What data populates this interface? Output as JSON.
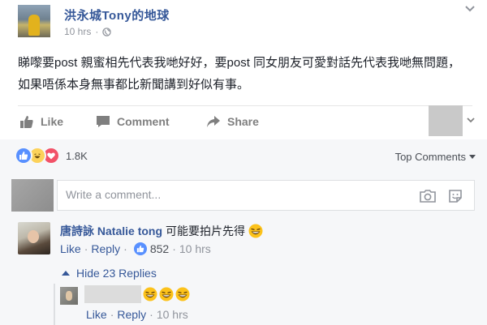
{
  "post": {
    "poster_name": "洪永城Tony的地球",
    "time": "10 hrs",
    "separator": "·",
    "text": "睇嚟要post 親蜜相先代表我哋好好，要post 同女朋友可愛對話先代表我哋無問題，如果唔係本身無事都比新聞講到好似有事。"
  },
  "actions": {
    "like": "Like",
    "comment": "Comment",
    "share": "Share"
  },
  "reactions": {
    "count": "1.8K",
    "types": [
      "like-icon",
      "haha-icon",
      "love-icon"
    ]
  },
  "sort": {
    "label": "Top Comments"
  },
  "composer": {
    "placeholder": "Write a comment..."
  },
  "comments": [
    {
      "author": "唐詩詠 Natalie tong",
      "text": "可能要拍片先得",
      "emoji": "laughing-emoji",
      "like": "Like",
      "reply": "Reply",
      "dot": "·",
      "likes": "852",
      "time": "10 hrs",
      "replies_toggle": "Hide 23 Replies",
      "replies": [
        {
          "emojis": [
            "laughing-emoji",
            "laughing-emoji",
            "laughing-emoji"
          ],
          "like": "Like",
          "reply": "Reply",
          "dot": "·",
          "time": "10 hrs"
        }
      ]
    }
  ],
  "colors": {
    "link": "#365899",
    "muted": "#90949c",
    "panel": "#f6f7f9",
    "like_blue": "#5890ff",
    "love_red": "#f25268",
    "haha_yellow": "#fcd25a"
  }
}
